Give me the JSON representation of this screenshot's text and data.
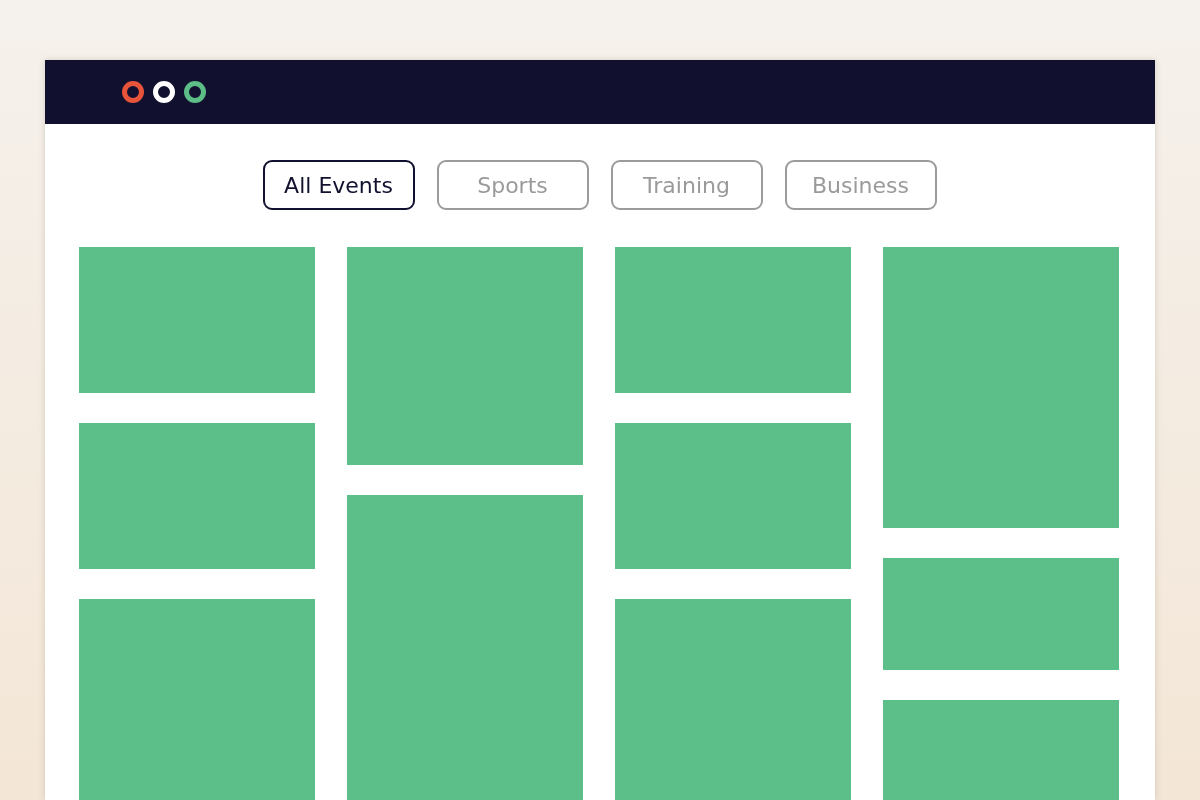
{
  "window": {
    "controls": [
      {
        "color": "#e8543a"
      },
      {
        "color": "#ffffff"
      },
      {
        "color": "#5cbd87"
      }
    ]
  },
  "filters": [
    {
      "label": "All Events",
      "selected": true
    },
    {
      "label": "Sports",
      "selected": false
    },
    {
      "label": "Training",
      "selected": false
    },
    {
      "label": "Business",
      "selected": false
    }
  ],
  "columns": [
    {
      "cards": [
        {
          "kind": "short"
        },
        {
          "kind": "short"
        },
        {
          "kind": "long"
        }
      ]
    },
    {
      "cards": [
        {
          "kind": "medium"
        },
        {
          "kind": "long"
        }
      ]
    },
    {
      "cards": [
        {
          "kind": "short"
        },
        {
          "kind": "short"
        },
        {
          "kind": "long"
        }
      ]
    },
    {
      "cards": [
        {
          "kind": "tall"
        },
        {
          "kind": "small"
        },
        {
          "kind": "long"
        }
      ]
    }
  ]
}
